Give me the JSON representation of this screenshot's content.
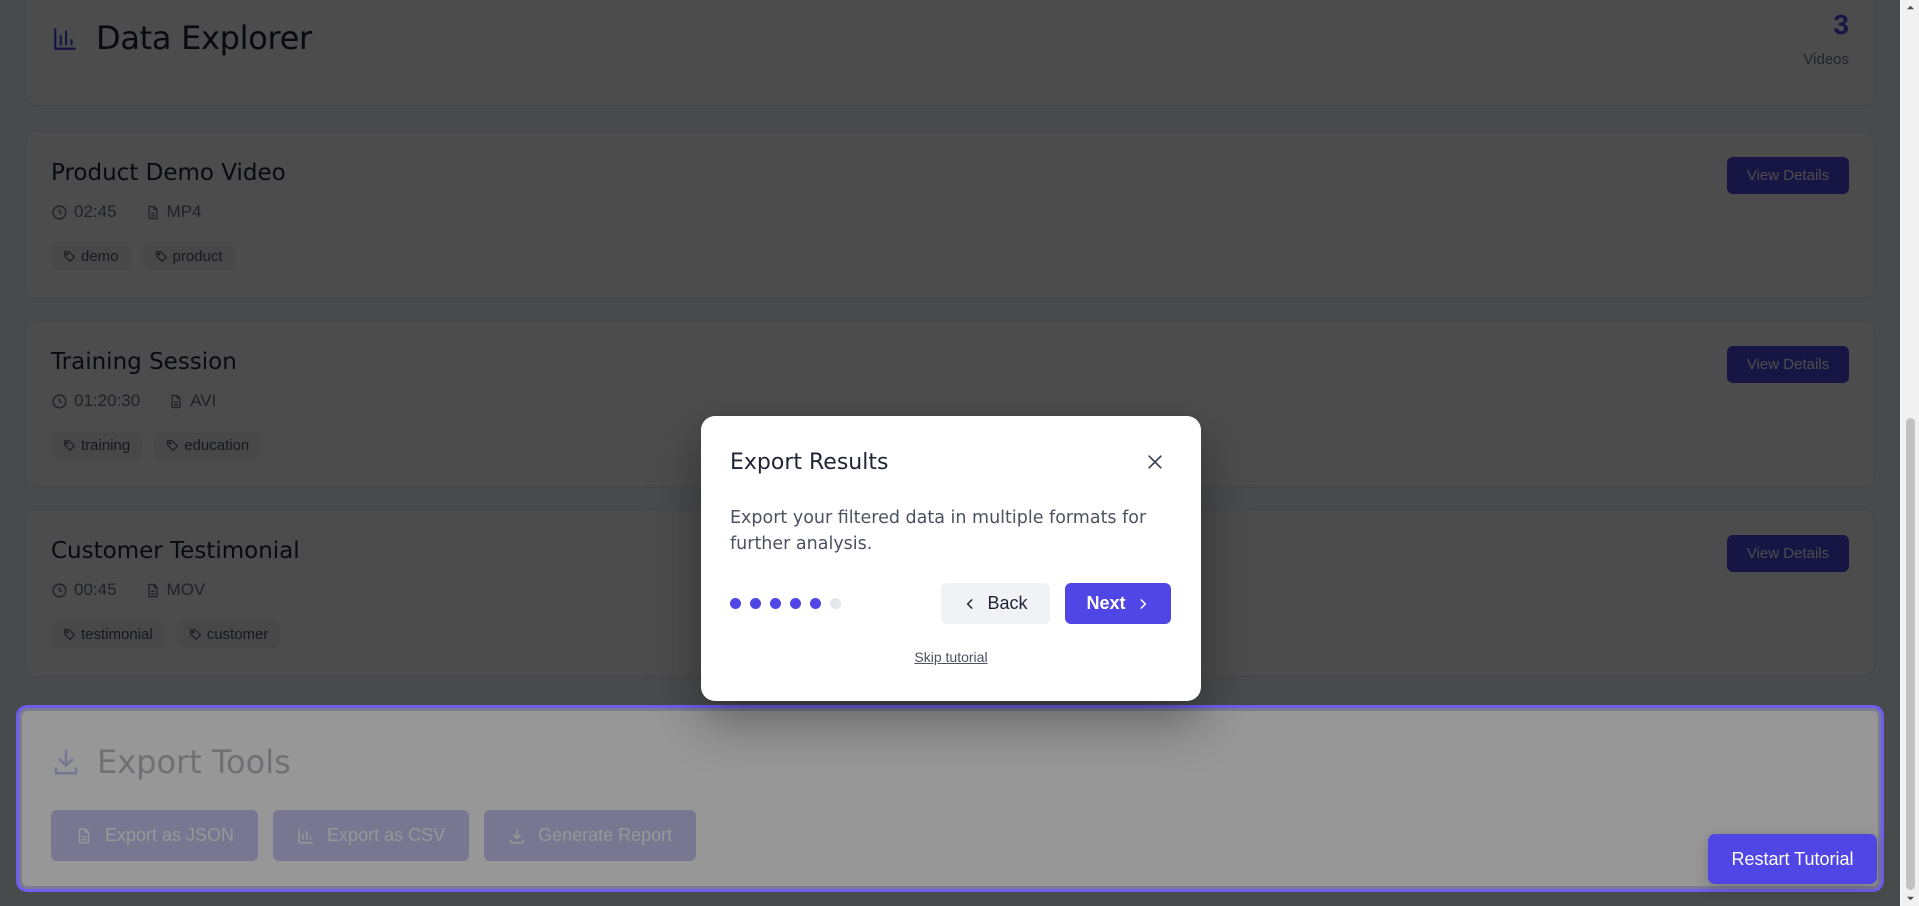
{
  "header": {
    "title": "Data Explorer",
    "icon": "bar-chart-icon",
    "count": "3",
    "count_label": "Videos"
  },
  "videos": [
    {
      "title": "Product Demo Video",
      "duration": "02:45",
      "format": "MP4",
      "tags": [
        "demo",
        "product"
      ],
      "button": "View Details"
    },
    {
      "title": "Training Session",
      "duration": "01:20:30",
      "format": "AVI",
      "tags": [
        "training",
        "education"
      ],
      "button": "View Details"
    },
    {
      "title": "Customer Testimonial",
      "duration": "00:45",
      "format": "MOV",
      "tags": [
        "testimonial",
        "customer"
      ],
      "button": "View Details"
    }
  ],
  "export_tools": {
    "title": "Export Tools",
    "icon": "download-icon",
    "buttons": [
      {
        "label": "Export as JSON",
        "icon": "file-icon"
      },
      {
        "label": "Export as CSV",
        "icon": "bar-chart-icon"
      },
      {
        "label": "Generate Report",
        "icon": "download-icon"
      }
    ]
  },
  "restart_button": "Restart Tutorial",
  "modal": {
    "title": "Export Results",
    "description": "Export your filtered data in multiple formats for further analysis.",
    "steps_total": 6,
    "current_step": 5,
    "back_label": "Back",
    "next_label": "Next",
    "skip_label": "Skip tutorial"
  },
  "colors": {
    "accent": "#4f46e5",
    "highlight_border": "#6d5ef0",
    "overlay": "rgba(0,0,0,0.70)"
  }
}
